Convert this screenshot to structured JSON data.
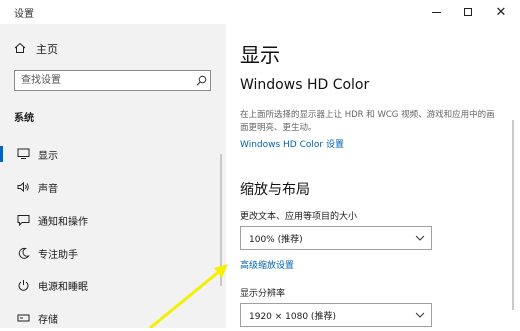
{
  "window": {
    "title": "设置",
    "controls": [
      "minimize",
      "maximize",
      "close"
    ]
  },
  "sidebar": {
    "home_label": "主页",
    "search_placeholder": "查找设置",
    "section_label": "系统",
    "items": [
      {
        "label": "显示",
        "icon": "monitor-icon",
        "active": true
      },
      {
        "label": "声音",
        "icon": "speaker-icon"
      },
      {
        "label": "通知和操作",
        "icon": "notification-icon"
      },
      {
        "label": "专注助手",
        "icon": "moon-icon"
      },
      {
        "label": "电源和睡眠",
        "icon": "power-icon"
      },
      {
        "label": "存储",
        "icon": "storage-icon"
      }
    ]
  },
  "main": {
    "title": "显示",
    "hd_color": {
      "heading": "Windows HD Color",
      "description": "在上面所选择的显示器上让 HDR 和 WCG 视频、游戏和应用中的画面更明亮、更生动。",
      "link": "Windows HD Color 设置"
    },
    "scale_layout": {
      "heading": "缩放与布局",
      "scale_label": "更改文本、应用等项目的大小",
      "scale_value": "100% (推荐)",
      "advanced_link": "高级缩放设置",
      "resolution_label": "显示分辨率",
      "resolution_value": "1920 × 1080 (推荐)"
    }
  },
  "colors": {
    "accent": "#0067c0",
    "link": "#0063b1",
    "sidebar_bg": "#f2f2f2",
    "arrow": "#ffff00"
  }
}
